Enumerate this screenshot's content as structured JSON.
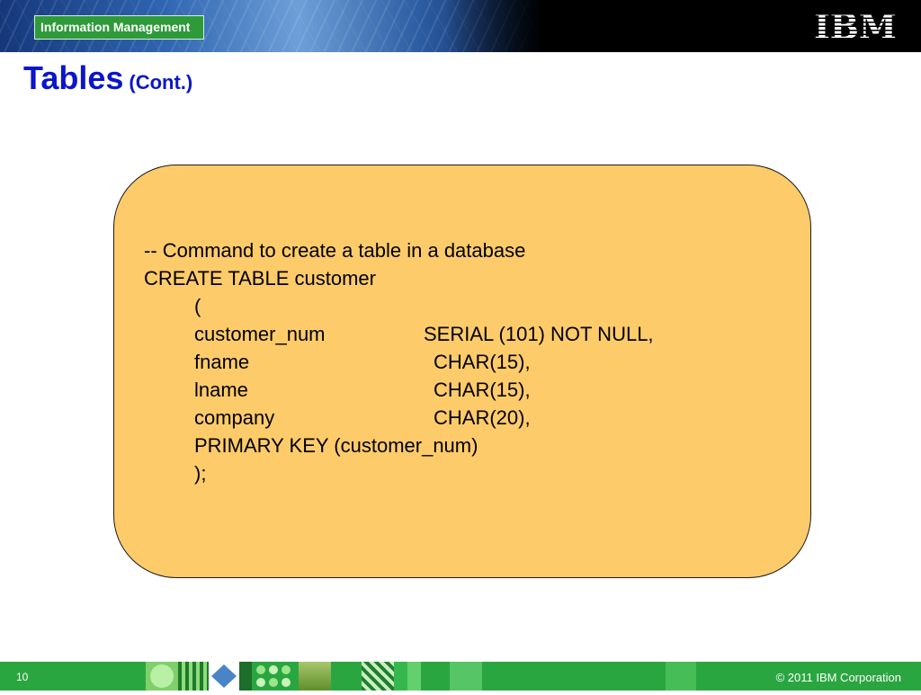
{
  "header": {
    "badge_text": "Information Management",
    "logo_text": "IBM"
  },
  "slide": {
    "title": "Tables",
    "title_suffix": "(Cont.)"
  },
  "code": {
    "comment": "-- Command to create a table in a database",
    "statement": "CREATE TABLE customer",
    "open_paren": "(",
    "columns": [
      {
        "name": "customer_num",
        "type": "SERIAL (101) NOT NULL,"
      },
      {
        "name": "fname",
        "type": "CHAR(15),"
      },
      {
        "name": "lname",
        "type": "CHAR(15),"
      },
      {
        "name": "company",
        "type": "CHAR(20),"
      }
    ],
    "primary_key": "PRIMARY KEY (customer_num)",
    "close": ");"
  },
  "footer": {
    "page_number": "10",
    "copyright": "© 2011 IBM Corporation"
  },
  "colors": {
    "title": "#0b16c9",
    "code_box_fill": "#fecb6b",
    "footer_green": "#2aa640",
    "badge_green": "#2f9a3a"
  }
}
